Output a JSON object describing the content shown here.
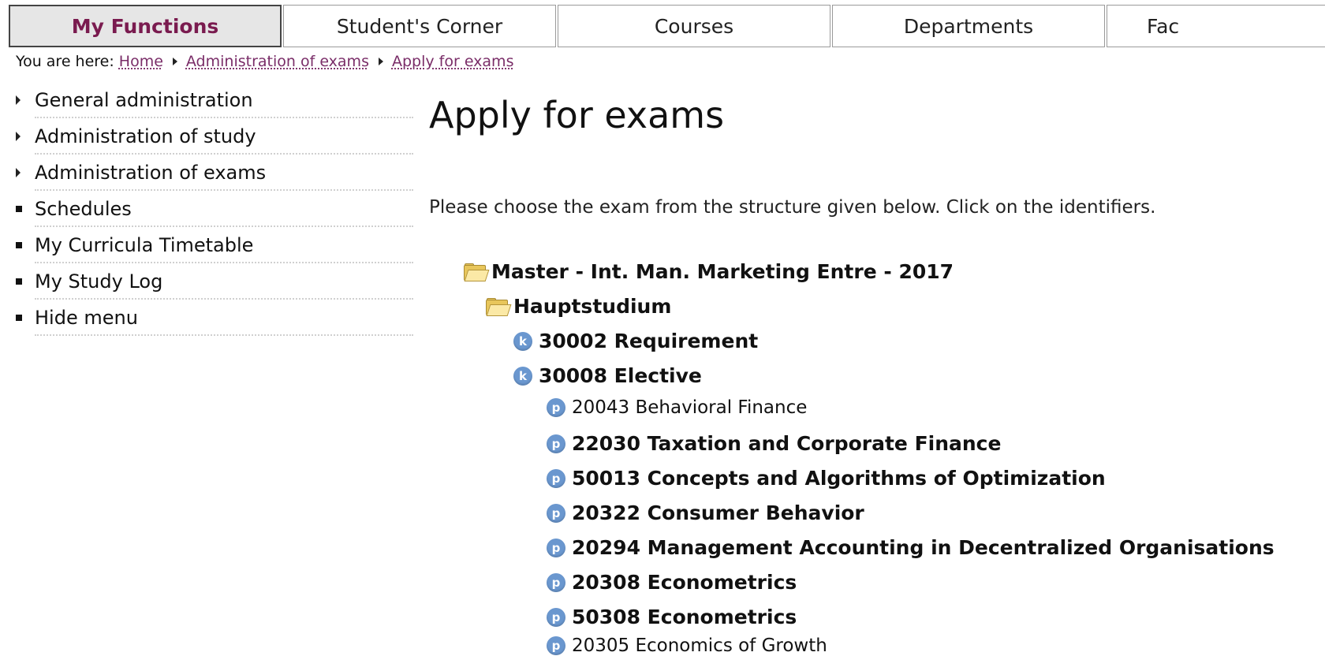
{
  "nav": {
    "tabs": [
      {
        "label": "My Functions"
      },
      {
        "label": "Student's Corner"
      },
      {
        "label": "Courses"
      },
      {
        "label": "Departments"
      },
      {
        "label": "Fac"
      }
    ]
  },
  "breadcrumb": {
    "prefix": "You are here:",
    "items": [
      "Home",
      "Administration of exams",
      "Apply for exams"
    ]
  },
  "sidebar": {
    "items": [
      {
        "label": "General administration",
        "icon": "triangle-right-icon"
      },
      {
        "label": "Administration of study",
        "icon": "triangle-right-icon"
      },
      {
        "label": "Administration of exams",
        "icon": "triangle-right-icon"
      },
      {
        "label": "Schedules",
        "icon": "square-bullet-icon"
      },
      {
        "label": "My Curricula Timetable",
        "icon": "square-bullet-icon"
      },
      {
        "label": "My Study Log",
        "icon": "square-bullet-icon"
      },
      {
        "label": "Hide menu",
        "icon": "square-bullet-icon"
      }
    ]
  },
  "main": {
    "title": "Apply for exams",
    "intro": "Please choose the exam from the structure given below. Click on the identifiers.",
    "tree": [
      {
        "icon": "folder-icon",
        "label": "Master - Int. Man. Marketing Entre - 2017",
        "level": 0
      },
      {
        "icon": "folder-icon",
        "label": "Hauptstudium",
        "level": 1
      },
      {
        "icon": "k-circle-icon",
        "glyph": "k",
        "label": "30002 Requirement",
        "level": 2
      },
      {
        "icon": "k-circle-icon",
        "glyph": "k",
        "label": "30008 Elective",
        "level": 2
      },
      {
        "icon": "p-circle-icon",
        "glyph": "p",
        "label": "20043 Behavioral Finance",
        "level": 3
      },
      {
        "icon": "p-circle-icon",
        "glyph": "p",
        "label": "22030 Taxation and Corporate Finance",
        "level": 3
      },
      {
        "icon": "p-circle-icon",
        "glyph": "p",
        "label": "50013 Concepts and Algorithms of Optimization",
        "level": 3
      },
      {
        "icon": "p-circle-icon",
        "glyph": "p",
        "label": "20322 Consumer Behavior",
        "level": 3
      },
      {
        "icon": "p-circle-icon",
        "glyph": "p",
        "label": "20294 Management Accounting in Decentralized Organisations",
        "level": 3
      },
      {
        "icon": "p-circle-icon",
        "glyph": "p",
        "label": "20308 Econometrics",
        "level": 3
      },
      {
        "icon": "p-circle-icon",
        "glyph": "p",
        "label": "50308 Econometrics",
        "level": 3
      },
      {
        "icon": "p-circle-icon",
        "glyph": "p",
        "label": "20305 Economics of Growth",
        "level": 3
      }
    ]
  },
  "colors": {
    "active_tab_text": "#7a1b4f",
    "link": "#7a2d68",
    "tree_icon_blue": "#6a97cf",
    "folder_yellow": "#e8c65b"
  }
}
